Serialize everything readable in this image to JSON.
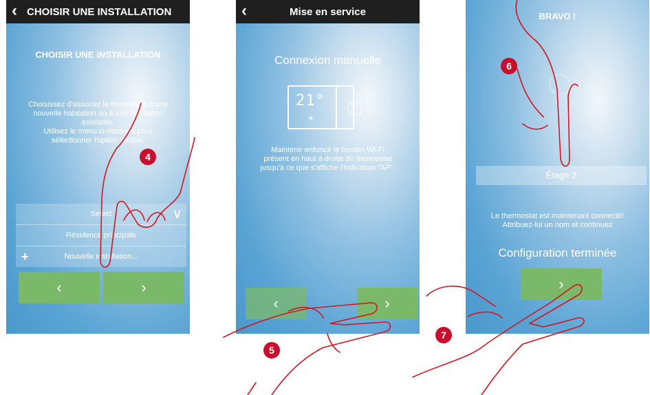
{
  "screen1": {
    "title": "CHOISIR UNE INSTALLATION",
    "heading": "CHOISIR UNE INSTALLATION",
    "instructions": [
      "Choisissez d'associer le thermostat à une",
      "nouvelle habitation ou à une habitation",
      "existante.",
      "Utilisez le menu ci-dessous pour",
      "sélectionner l'option voulue."
    ],
    "menu": {
      "select_label": "Select",
      "option1": "Rèsidence principale",
      "option2": "Nouvelle installation..."
    },
    "prev_label": "‹",
    "next_label": "›"
  },
  "screen2": {
    "title": "Mise en service",
    "heading": "Connexion manuelle",
    "thermostat_display": "21°",
    "instructions": [
      "Maintenir enfoncé le bouton Wi-Fi",
      "présent en haut à droite du thermostat",
      "jusqu'à ce que s'affiche l'indication \"AP\"."
    ],
    "prev_label": "‹",
    "next_label": "›"
  },
  "screen3": {
    "title": "BRAVO !",
    "name_field_value": "Étage 2",
    "message": [
      "Le thermostat est maintenant connecté!",
      "Attribuez-lui un nom et continuez"
    ],
    "status": "Configuration terminée",
    "next_label": "›"
  },
  "callouts": [
    "4",
    "5",
    "6",
    "7"
  ],
  "colors": {
    "topbar": "#1f1f1f",
    "button_green": "#7bb96a",
    "callout_red": "#c8102e",
    "sketch_line": "#d4141f"
  }
}
